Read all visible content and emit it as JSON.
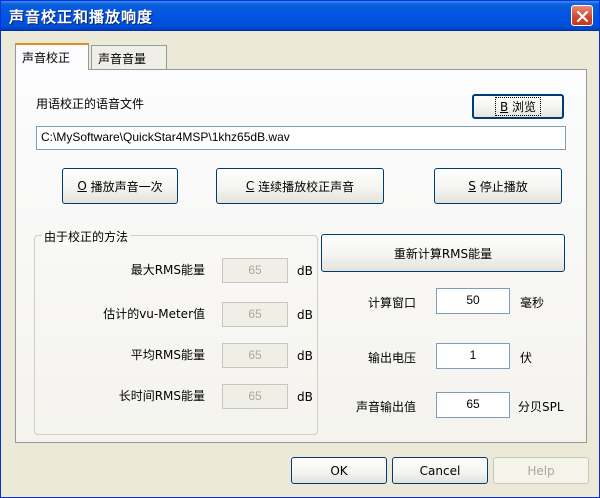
{
  "window": {
    "title": "声音校正和播放响度"
  },
  "tabs": [
    {
      "label": "声音校正",
      "active": true
    },
    {
      "label": "声音音量",
      "active": false
    }
  ],
  "file_section": {
    "label": "用语校正的语音文件",
    "browse_accel": "B",
    "browse_label": "浏览",
    "path_value": "C:\\MySoftware\\QuickStar4MSP\\1khz65dB.wav"
  },
  "actions": {
    "play_once": {
      "accel": "O",
      "label": "播放声音一次"
    },
    "play_loop": {
      "accel": "C",
      "label": "连续播放校正声音"
    },
    "stop": {
      "accel": "S",
      "label": "停止播放"
    }
  },
  "method_group": {
    "title": "由于校正的方法",
    "rows": [
      {
        "label": "最大RMS能量",
        "value": "65",
        "unit": "dB"
      },
      {
        "label": "估计的vu-Meter值",
        "value": "65",
        "unit": "dB"
      },
      {
        "label": "平均RMS能量",
        "value": "65",
        "unit": "dB"
      },
      {
        "label": "长时间RMS能量",
        "value": "65",
        "unit": "dB"
      }
    ]
  },
  "recalc_button": "重新计算RMS能量",
  "settings": [
    {
      "label": "计算窗口",
      "value": "50",
      "unit": "毫秒"
    },
    {
      "label": "输出电压",
      "value": "1",
      "unit": "伏"
    },
    {
      "label": "声音输出值",
      "value": "65",
      "unit": "分贝SPL"
    }
  ],
  "footer": {
    "ok": "OK",
    "cancel": "Cancel",
    "help": "Help"
  },
  "colors": {
    "titlebar": "#0054e3",
    "window_bg": "#ece9d8",
    "close_button": "#d2442a",
    "active_tab_accent": "#e68b2c"
  }
}
